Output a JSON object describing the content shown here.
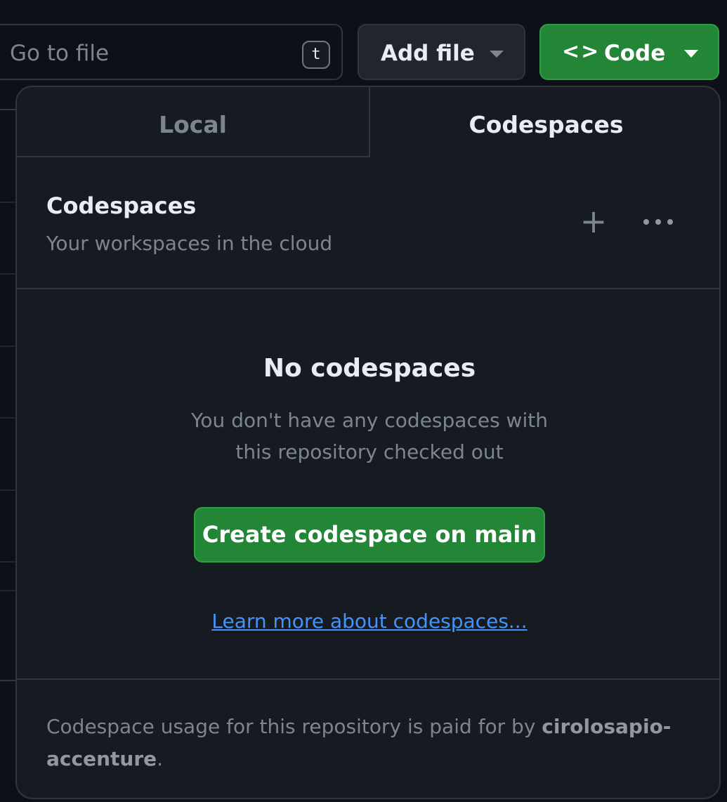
{
  "toolbar": {
    "goto_placeholder": "Go to file",
    "goto_shortcut": "t",
    "add_file_label": "Add file",
    "code_label": "Code",
    "code_icon_glyph": "<>"
  },
  "popover": {
    "tabs": [
      {
        "label": "Local",
        "selected": false
      },
      {
        "label": "Codespaces",
        "selected": true
      }
    ],
    "section": {
      "title": "Codespaces",
      "subtitle": "Your workspaces in the cloud"
    },
    "empty_state": {
      "title": "No codespaces",
      "description": "You don't have any codespaces with this repository checked out",
      "create_button": "Create codespace on main",
      "learn_link": "Learn more about codespaces..."
    },
    "footer": {
      "text_before": "Codespace usage for this repository is paid for by ",
      "owner": "cirolosapio-accenture",
      "text_after": "."
    }
  },
  "icons": {
    "plus": "plus-icon",
    "more": "kebab-horizontal-icon",
    "code": "code-icon",
    "caret": "triangle-down-icon"
  },
  "colors": {
    "background": "#0d1117",
    "panel": "#161b22",
    "border": "#30363d",
    "primary_green": "#238636",
    "link_blue": "#4493f8",
    "muted_text": "#7d8590",
    "text": "#e6edf3"
  }
}
